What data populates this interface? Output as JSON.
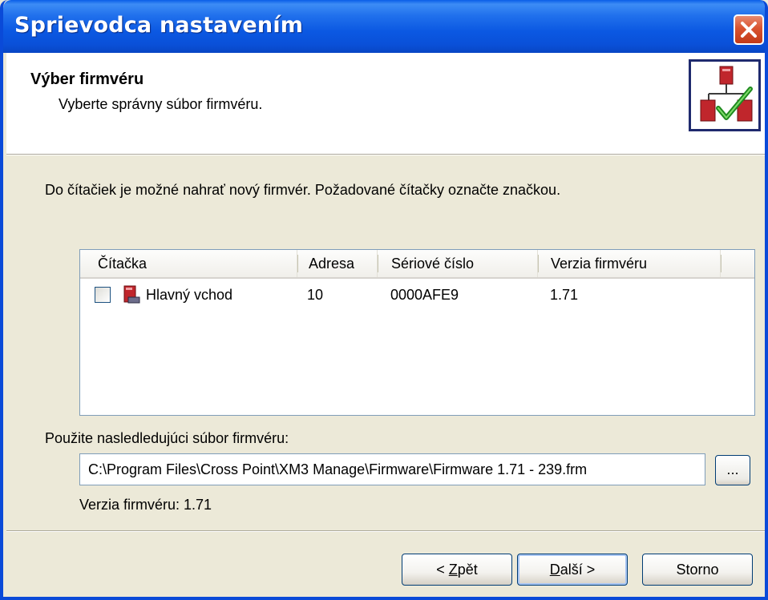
{
  "window": {
    "title": "Sprievodca nastavením",
    "close_icon": "close-icon",
    "titlebar_color": "#0a5ee8",
    "close_color": "#d9532f"
  },
  "header": {
    "title": "Výber firmvéru",
    "subtitle": "Vyberte správny súbor firmvéru.",
    "icon": "firmware-wizard-icon"
  },
  "instruction": "Do čítačiek je možné nahrať nový firmvér. Požadované čítačky označte značkou.",
  "table": {
    "columns": [
      "Čítačka",
      "Adresa",
      "Sériové číslo",
      "Verzia firmvéru"
    ],
    "rows": [
      {
        "checked": false,
        "icon": "reader-icon",
        "name": "Hlavný vchod",
        "address": "10",
        "serial": "0000AFE9",
        "firmware": "1.71"
      }
    ]
  },
  "file": {
    "label": "Použite nasledledujúci súbor firmvéru:",
    "path": "C:\\Program Files\\Cross Point\\XM3 Manage\\Firmware\\Firmware 1.71 - 239.frm",
    "browse_label": "...",
    "version_text": "Verzia firmvéru: 1.71"
  },
  "buttons": {
    "back_pre": "< ",
    "back_key": "Z",
    "back_post": "pět",
    "next_key": "D",
    "next_post": "alší >",
    "cancel": "Storno"
  }
}
